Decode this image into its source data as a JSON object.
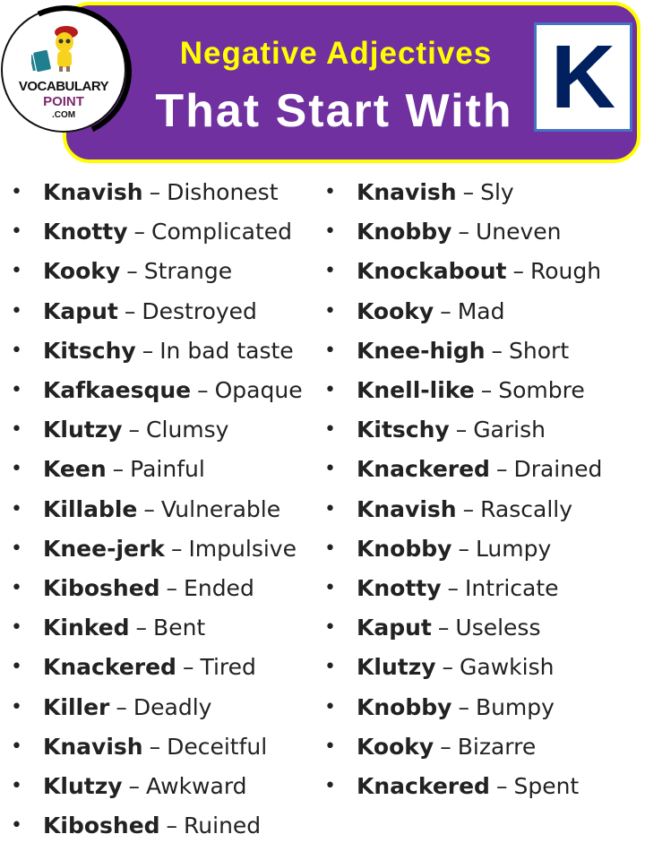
{
  "header": {
    "title_line1": "Negative Adjectives",
    "title_line2": "That Start With",
    "letter": "K",
    "colors": {
      "banner_bg": "#7030a0",
      "banner_border": "#ffff00",
      "title_line1": "#ffff00",
      "title_line2": "#ffffff",
      "letter": "#002060",
      "letter_box_border": "#4472c4"
    }
  },
  "logo": {
    "line1": "VOCABULARY",
    "line2": "POINT",
    "line3": ".COM",
    "icons": [
      "mascot-icon",
      "book-icon"
    ]
  },
  "separator": "–",
  "bullet": "•",
  "list": {
    "left": [
      {
        "word": "Knavish",
        "meaning": "Dishonest"
      },
      {
        "word": "Knotty",
        "meaning": "Complicated"
      },
      {
        "word": "Kooky",
        "meaning": "Strange"
      },
      {
        "word": "Kaput",
        "meaning": "Destroyed"
      },
      {
        "word": "Kitschy",
        "meaning": "In bad taste"
      },
      {
        "word": "Kafkaesque",
        "meaning": "Opaque"
      },
      {
        "word": "Klutzy",
        "meaning": "Clumsy"
      },
      {
        "word": "Keen",
        "meaning": "Painful"
      },
      {
        "word": "Killable",
        "meaning": "Vulnerable"
      },
      {
        "word": "Knee-jerk",
        "meaning": "Impulsive"
      },
      {
        "word": "Kiboshed",
        "meaning": "Ended"
      },
      {
        "word": "Kinked",
        "meaning": "Bent"
      },
      {
        "word": "Knackered",
        "meaning": "Tired"
      },
      {
        "word": "Killer",
        "meaning": "Deadly"
      },
      {
        "word": "Knavish",
        "meaning": "Deceitful"
      },
      {
        "word": "Klutzy",
        "meaning": "Awkward"
      },
      {
        "word": "Kiboshed",
        "meaning": "Ruined"
      }
    ],
    "right": [
      {
        "word": "Knavish",
        "meaning": "Sly"
      },
      {
        "word": "Knobby",
        "meaning": "Uneven"
      },
      {
        "word": "Knockabout",
        "meaning": "Rough"
      },
      {
        "word": "Kooky",
        "meaning": "Mad"
      },
      {
        "word": "Knee-high",
        "meaning": "Short"
      },
      {
        "word": "Knell-like",
        "meaning": "Sombre"
      },
      {
        "word": "Kitschy",
        "meaning": "Garish"
      },
      {
        "word": "Knackered",
        "meaning": "Drained"
      },
      {
        "word": "Knavish",
        "meaning": "Rascally"
      },
      {
        "word": "Knobby",
        "meaning": "Lumpy"
      },
      {
        "word": "Knotty",
        "meaning": "Intricate"
      },
      {
        "word": "Kaput",
        "meaning": "Useless"
      },
      {
        "word": "Klutzy",
        "meaning": "Gawkish"
      },
      {
        "word": "Knobby",
        "meaning": "Bumpy"
      },
      {
        "word": "Kooky",
        "meaning": "Bizarre"
      },
      {
        "word": "Knackered",
        "meaning": "Spent"
      }
    ]
  }
}
